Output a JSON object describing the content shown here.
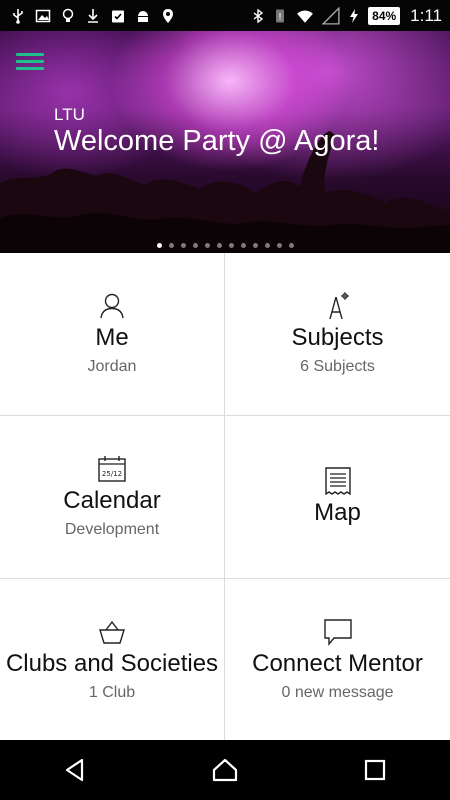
{
  "status_bar": {
    "battery": "84%",
    "time": "1:11"
  },
  "hero": {
    "kicker": "LTU",
    "title": "Welcome Party @ Agora!",
    "slide_count": 12,
    "active_slide": 1
  },
  "tiles": [
    {
      "title": "Me",
      "subtitle": "Jordan",
      "icon": "user-icon"
    },
    {
      "title": "Subjects",
      "subtitle": "6 Subjects",
      "icon": "compass-icon"
    },
    {
      "title": "Calendar",
      "subtitle": "Development",
      "icon": "calendar-icon"
    },
    {
      "title": "Map",
      "subtitle": "",
      "icon": "map-icon"
    },
    {
      "title": "Clubs and Societies",
      "subtitle": "1 Club",
      "icon": "basket-icon"
    },
    {
      "title": "Connect Mentor",
      "subtitle": "0 new message",
      "icon": "chat-bubble-icon"
    }
  ],
  "calendar_icon_text": "25/12",
  "colors": {
    "menu_accent": "#1fc08a",
    "status_bar_bg": "#050505",
    "nav_bar_bg": "#000000",
    "tile_divider": "#dcdcdc"
  }
}
